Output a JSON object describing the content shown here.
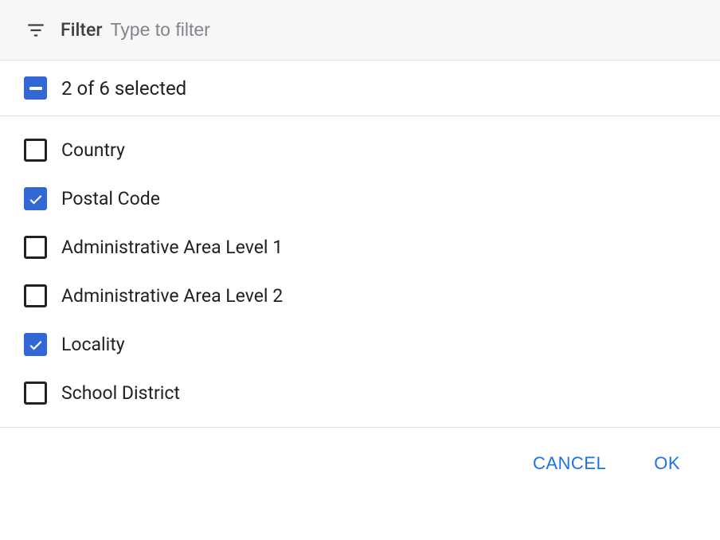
{
  "filter": {
    "label": "Filter",
    "placeholder": "Type to filter"
  },
  "selection": {
    "summary": "2 of 6 selected"
  },
  "options": [
    {
      "label": "Country",
      "checked": false
    },
    {
      "label": "Postal Code",
      "checked": true
    },
    {
      "label": "Administrative Area Level 1",
      "checked": false
    },
    {
      "label": "Administrative Area Level 2",
      "checked": false
    },
    {
      "label": "Locality",
      "checked": true
    },
    {
      "label": "School District",
      "checked": false
    }
  ],
  "buttons": {
    "cancel": "CANCEL",
    "ok": "OK"
  }
}
